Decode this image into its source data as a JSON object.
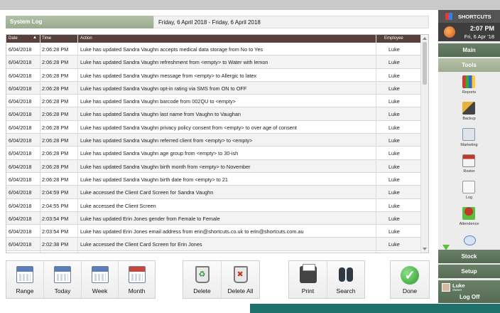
{
  "header": {
    "label": "System Log",
    "date_range": "Friday, 6 April 2018 - Friday, 6 April 2018"
  },
  "table": {
    "columns": {
      "date": "Date",
      "time": "Time",
      "action": "Action",
      "employee": "Employee"
    },
    "rows": [
      {
        "date": "6/04/2018",
        "time": "2:06:28 PM",
        "action": "Luke has updated Sandra Vaughn accepts medical data storage from No to Yes",
        "employee": "Luke"
      },
      {
        "date": "6/04/2018",
        "time": "2:06:28 PM",
        "action": "Luke has updated Sandra Vaughn refreshment from <empty> to Water with lemon",
        "employee": "Luke"
      },
      {
        "date": "6/04/2018",
        "time": "2:06:28 PM",
        "action": "Luke has updated Sandra Vaughn message from <empty> to Allergic to latex",
        "employee": "Luke"
      },
      {
        "date": "6/04/2018",
        "time": "2:06:28 PM",
        "action": "Luke has updated Sandra Vaughn opt-in rating via SMS from ON to OFF",
        "employee": "Luke"
      },
      {
        "date": "6/04/2018",
        "time": "2:06:28 PM",
        "action": "Luke has updated Sandra Vaughn barcode from 002QU to <empty>",
        "employee": "Luke"
      },
      {
        "date": "6/04/2018",
        "time": "2:06:28 PM",
        "action": "Luke has updated Sandra Vaughn last name from Vaughn to Vaughan",
        "employee": "Luke"
      },
      {
        "date": "6/04/2018",
        "time": "2:06:28 PM",
        "action": "Luke has updated Sandra Vaughn privacy policy consent from <empty> to over age of consent",
        "employee": "Luke"
      },
      {
        "date": "6/04/2018",
        "time": "2:06:28 PM",
        "action": "Luke has updated Sandra Vaughn referred client from <empty> to <empty>",
        "employee": "Luke"
      },
      {
        "date": "6/04/2018",
        "time": "2:06:28 PM",
        "action": "Luke has updated Sandra Vaughn age group from <empty> to 30-ish",
        "employee": "Luke"
      },
      {
        "date": "6/04/2018",
        "time": "2:06:28 PM",
        "action": "Luke has updated Sandra Vaughn birth month from <empty> to November",
        "employee": "Luke"
      },
      {
        "date": "6/04/2018",
        "time": "2:06:28 PM",
        "action": "Luke has updated Sandra Vaughn birth date from <empty> to 21",
        "employee": "Luke"
      },
      {
        "date": "6/04/2018",
        "time": "2:04:59 PM",
        "action": "Luke accessed the Client Card Screen for Sandra Vaughn",
        "employee": "Luke"
      },
      {
        "date": "6/04/2018",
        "time": "2:04:55 PM",
        "action": "Luke accessed the Client Screen",
        "employee": "Luke"
      },
      {
        "date": "6/04/2018",
        "time": "2:03:54 PM",
        "action": "Luke has updated Erin Jones gender from Female to Female",
        "employee": "Luke"
      },
      {
        "date": "6/04/2018",
        "time": "2:03:54 PM",
        "action": "Luke has updated Erin Jones email address from erin@shortcuts.co.uk to erin@shortcuts.com.au",
        "employee": "Luke"
      },
      {
        "date": "6/04/2018",
        "time": "2:02:38 PM",
        "action": "Luke accessed the Client Card Screen for Erin Jones",
        "employee": "Luke"
      },
      {
        "date": "",
        "time": "",
        "action": "",
        "employee": ""
      }
    ]
  },
  "toolbar": {
    "range": "Range",
    "today": "Today",
    "week": "Week",
    "month": "Month",
    "delete": "Delete",
    "delete_all": "Delete All",
    "print": "Print",
    "search": "Search",
    "done": "Done"
  },
  "panel": {
    "brand": "SHORTCUTS",
    "time": "2:07 PM",
    "date": "Fri, 6 Apr '18",
    "main": "Main",
    "tools": "Tools",
    "tool_items": [
      "Reports",
      "Backup",
      "Marketing",
      "Roster",
      "Log",
      "Attendence"
    ],
    "stock": "Stock",
    "setup": "Setup",
    "user_name": "Luke",
    "user_role": "Owner",
    "logoff": "Log Off"
  },
  "colors": {
    "accent": "#56413e",
    "nav_green": "#5f755e",
    "teal": "#1f6f6b"
  }
}
